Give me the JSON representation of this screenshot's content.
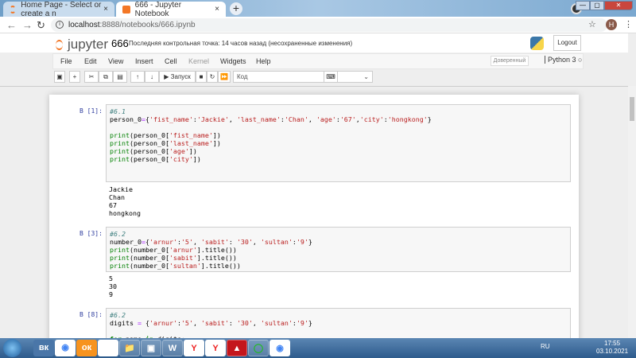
{
  "browser": {
    "tabs": [
      {
        "title": "Home Page - Select or create a n",
        "close": "×"
      },
      {
        "title": "666 - Jupyter Notebook",
        "close": "×"
      }
    ],
    "new_tab": "+",
    "url_host": "localhost",
    "url_path": ":8888/notebooks/666.ipynb",
    "avatar": "H",
    "window_buttons": [
      "—",
      "▢",
      "✕"
    ]
  },
  "jupyter": {
    "logo": "jupyter",
    "notebook_name": "666",
    "checkpoint": "Последняя контрольная точка: 14 часов назад   (несохраненные изменения)",
    "logout": "Logout",
    "menu": [
      "File",
      "Edit",
      "View",
      "Insert",
      "Cell",
      "Kernel",
      "Widgets",
      "Help"
    ],
    "trusted": "Доверенный",
    "kernel": "Python 3",
    "toolbar": {
      "run": "▶ Запуск",
      "cell_type": "Код"
    }
  },
  "cells": [
    {
      "prompt": "В [1]:",
      "code": [
        [
          [
            "#6.1",
            "c"
          ]
        ],
        [
          [
            "person_0",
            "n"
          ],
          [
            "=",
            "o"
          ],
          [
            "{",
            "n"
          ],
          [
            "'fist_name'",
            "s"
          ],
          [
            ":",
            "n"
          ],
          [
            "'Jackie'",
            "s"
          ],
          [
            ", ",
            "n"
          ],
          [
            "'last_name'",
            "s"
          ],
          [
            ":",
            "n"
          ],
          [
            "'Chan'",
            "s"
          ],
          [
            ", ",
            "n"
          ],
          [
            "'age'",
            "s"
          ],
          [
            ":",
            "n"
          ],
          [
            "'67'",
            "s"
          ],
          [
            ",",
            "n"
          ],
          [
            "'city'",
            "s"
          ],
          [
            ":",
            "n"
          ],
          [
            "'hongkong'",
            "s"
          ],
          [
            "}",
            "n"
          ]
        ],
        [],
        [
          [
            "print",
            "b"
          ],
          [
            "(person_0[",
            "n"
          ],
          [
            "'fist_name'",
            "s"
          ],
          [
            "])",
            "n"
          ]
        ],
        [
          [
            "print",
            "b"
          ],
          [
            "(person_0[",
            "n"
          ],
          [
            "'last_name'",
            "s"
          ],
          [
            "])",
            "n"
          ]
        ],
        [
          [
            "print",
            "b"
          ],
          [
            "(person_0[",
            "n"
          ],
          [
            "'age'",
            "s"
          ],
          [
            "])",
            "n"
          ]
        ],
        [
          [
            "print",
            "b"
          ],
          [
            "(person_0[",
            "n"
          ],
          [
            "'city'",
            "s"
          ],
          [
            "])",
            "n"
          ]
        ],
        [],
        [],
        []
      ],
      "output": "Jackie\nChan\n67\nhongkong"
    },
    {
      "prompt": "В [3]:",
      "code": [
        [
          [
            "#6.2",
            "c"
          ]
        ],
        [
          [
            "number_0",
            "n"
          ],
          [
            "=",
            "o"
          ],
          [
            "{",
            "n"
          ],
          [
            "'arnur'",
            "s"
          ],
          [
            ":",
            "n"
          ],
          [
            "'5'",
            "s"
          ],
          [
            ", ",
            "n"
          ],
          [
            "'sabit'",
            "s"
          ],
          [
            ": ",
            "n"
          ],
          [
            "'30'",
            "s"
          ],
          [
            ", ",
            "n"
          ],
          [
            "'sultan'",
            "s"
          ],
          [
            ":",
            "n"
          ],
          [
            "'9'",
            "s"
          ],
          [
            "}",
            "n"
          ]
        ],
        [
          [
            "print",
            "b"
          ],
          [
            "(number_0[",
            "n"
          ],
          [
            "'arnur'",
            "s"
          ],
          [
            "].title())",
            "n"
          ]
        ],
        [
          [
            "print",
            "b"
          ],
          [
            "(number_0[",
            "n"
          ],
          [
            "'sabit'",
            "s"
          ],
          [
            "].title())",
            "n"
          ]
        ],
        [
          [
            "print",
            "b"
          ],
          [
            "(number_0[",
            "n"
          ],
          [
            "'sultan'",
            "s"
          ],
          [
            "].title())",
            "n"
          ]
        ]
      ],
      "output": "5\n30\n9"
    },
    {
      "prompt": "В [8]:",
      "code": [
        [
          [
            "#6.2",
            "c"
          ]
        ],
        [
          [
            "digits ",
            "n"
          ],
          [
            "=",
            "o"
          ],
          [
            " {",
            "n"
          ],
          [
            "'arnur'",
            "s"
          ],
          [
            ":",
            "n"
          ],
          [
            "'5'",
            "s"
          ],
          [
            ", ",
            "n"
          ],
          [
            "'sabit'",
            "s"
          ],
          [
            ": ",
            "n"
          ],
          [
            "'30'",
            "s"
          ],
          [
            ", ",
            "n"
          ],
          [
            "'sultan'",
            "s"
          ],
          [
            ":",
            "n"
          ],
          [
            "'9'",
            "s"
          ],
          [
            "}",
            "n"
          ]
        ],
        [],
        [
          [
            "for",
            "k"
          ],
          [
            " name ",
            "n"
          ],
          [
            "in",
            "k"
          ],
          [
            " digits:",
            "n"
          ]
        ]
      ],
      "output": ""
    }
  ],
  "taskbar": {
    "apps": [
      "вк",
      "◉",
      "ок",
      "Я",
      "📁",
      "▣",
      "W",
      "Y",
      "Y",
      "▲",
      "◯",
      "◉"
    ],
    "lang": "RU",
    "time": "17:55",
    "date": "03.10.2021"
  }
}
